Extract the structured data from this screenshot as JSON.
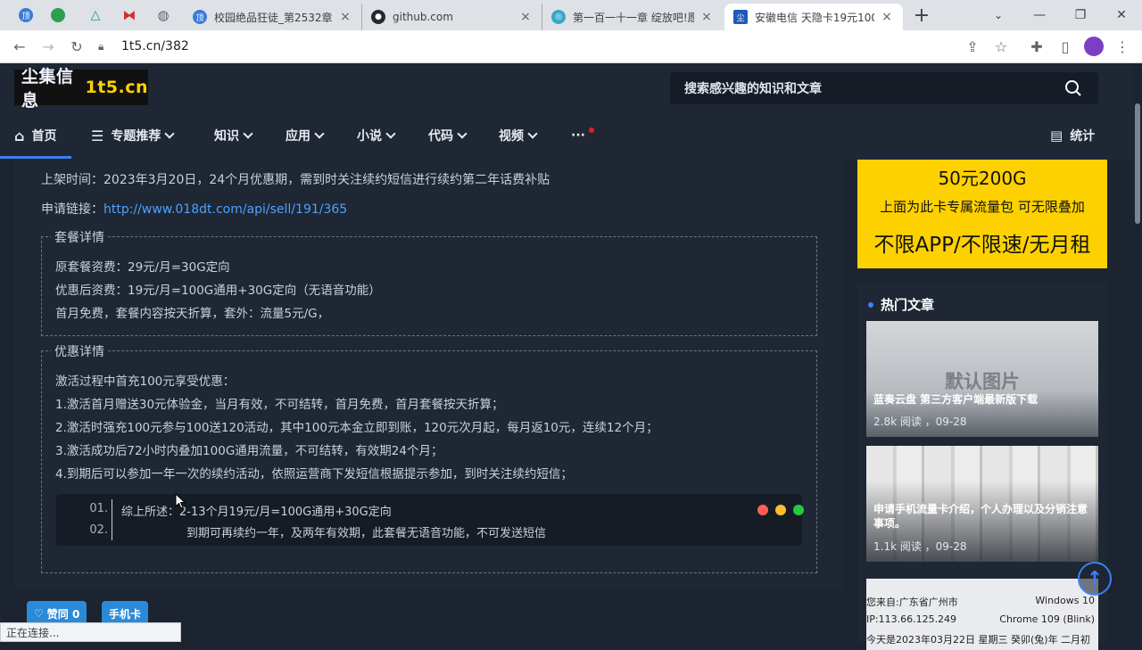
{
  "browser": {
    "tabs": [
      {
        "title": "校园绝品狂徒_第2532章",
        "close": "×"
      },
      {
        "title": "github.com",
        "close": "×"
      },
      {
        "title": "第一百一十一章 绽放吧!愿",
        "close": "×"
      },
      {
        "title": "安徽电信 天隐卡19元100",
        "close": "×"
      }
    ],
    "new_tab": "+",
    "url": "1t5.cn/382",
    "status": "正在连接..."
  },
  "site": {
    "logo_cn": "尘集信息",
    "logo_domain": "1t5.cn",
    "search_placeholder": "搜索感兴趣的知识和文章",
    "nav": [
      {
        "label": "首页"
      },
      {
        "label": "专题推荐"
      },
      {
        "label": "知识"
      },
      {
        "label": "应用"
      },
      {
        "label": "小说"
      },
      {
        "label": "代码"
      },
      {
        "label": "视频"
      },
      {
        "label": "···"
      },
      {
        "label": "统计"
      }
    ]
  },
  "article": {
    "listing_time": "上架时间：2023年3月20日，24个月优惠期，需到时关注续约短信进行续约第二年话费补贴",
    "apply_label": "申请链接：",
    "apply_link": "http://www.018dt.com/api/sell/191/365",
    "package": {
      "legend": "套餐详情",
      "lines": [
        "原套餐资费：29元/月=30G定向",
        "优惠后资费：19元/月=100G通用+30G定向（无语音功能）",
        "首月免费，套餐内容按天折算，套外：流量5元/G，"
      ]
    },
    "promo": {
      "legend": "优惠详情",
      "lines": [
        "激活过程中首充100元享受优惠：",
        "1.激活首月赠送30元体验金，当月有效，不可结转，首月免费，首月套餐按天折算；",
        "2.激活时强充100元参与100送120活动，其中100元本金立即到账，120元次月起，每月返10元，连续12个月；",
        "3.激活成功后72小时内叠加100G通用流量，不可结转，有效期24个月；",
        "4.到期后可以参加一年一次的续约活动，依照运营商下发短信根据提示参加，到时关注续约短信；"
      ]
    },
    "code": {
      "line_numbers": [
        "01.",
        "02."
      ],
      "lines": [
        "综上所述：2-13个月19元/月=100G通用+30G定向",
        "到期可再续约一年，及两年有效期，此套餐无语音功能，不可发送短信"
      ],
      "dot_colors": [
        "#ff5f56",
        "#ffbd2e",
        "#27c93f"
      ]
    },
    "like_button": "赞同 0",
    "tag": "手机卡"
  },
  "sidebar": {
    "ad_lines": [
      "50元200G",
      "上面为此卡专属流量包  可无限叠加",
      "不限APP/不限速/无月租"
    ],
    "hot_title": "热门文章",
    "cards": [
      {
        "image_text": "默认图片",
        "title": "蓝奏云盘 第三方客户端最新版下载",
        "meta": "2.8k 阅读 ，09-28"
      },
      {
        "title": "申请手机流量卡介绍，个人办理以及分销注意事项。",
        "meta": "1.1k 阅读 ，09-28"
      },
      {
        "visitor_lines": [
          "您来自:广东省广州市",
          "IP:113.66.125.249",
          "今天是2023年03月22日 星期三 癸卯(兔)年 二月初"
        ],
        "os": "Windows 10",
        "browser": "Chrome 109 (Blink)"
      }
    ]
  },
  "colors": {
    "accent": "#3b82f6",
    "link": "#4ea1ff",
    "ad_yellow": "#fdd100",
    "page_bg": "#1b2430"
  }
}
